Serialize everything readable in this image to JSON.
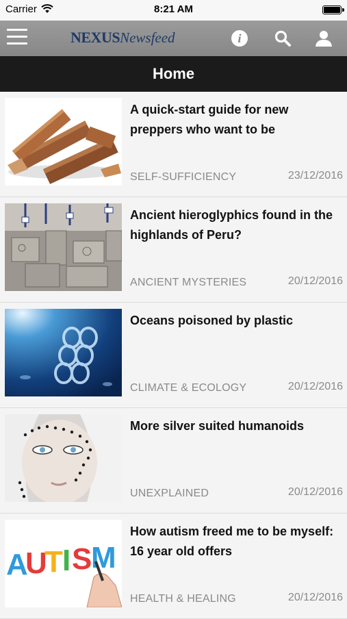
{
  "status_bar": {
    "carrier": "Carrier",
    "time": "8:21 AM"
  },
  "nav": {
    "logo_primary": "NEXUS",
    "logo_secondary": "Newsfeed",
    "info_label": "i",
    "icons": [
      "menu-icon",
      "info-icon",
      "search-icon",
      "user-icon"
    ]
  },
  "title_bar": {
    "title": "Home"
  },
  "articles": [
    {
      "headline": "A quick-start guide for new preppers who want to be",
      "category": "SELF-SUFFICIENCY",
      "date": "23/12/2016",
      "image": "firewood-logs"
    },
    {
      "headline": "Ancient hieroglyphics found in the highlands of Peru?",
      "category": "ANCIENT MYSTERIES",
      "date": "20/12/2016",
      "image": "carved-stone-blocks"
    },
    {
      "headline": "Oceans poisoned by plastic",
      "category": "CLIMATE & ECOLOGY",
      "date": "20/12/2016",
      "image": "plastic-ring-underwater"
    },
    {
      "headline": "More silver suited humanoids",
      "category": "UNEXPLAINED",
      "date": "20/12/2016",
      "image": "painted-face"
    },
    {
      "headline": "How autism freed me to be myself: 16 year old offers",
      "category": "HEALTH & HEALING",
      "date": "20/12/2016",
      "image": "autism-lettering"
    }
  ],
  "colors": {
    "nav_bar": "#8f8f8f",
    "title_bar": "#1b1b1b",
    "logo": "#1f3a68",
    "meta_text": "#8a8a8a"
  }
}
